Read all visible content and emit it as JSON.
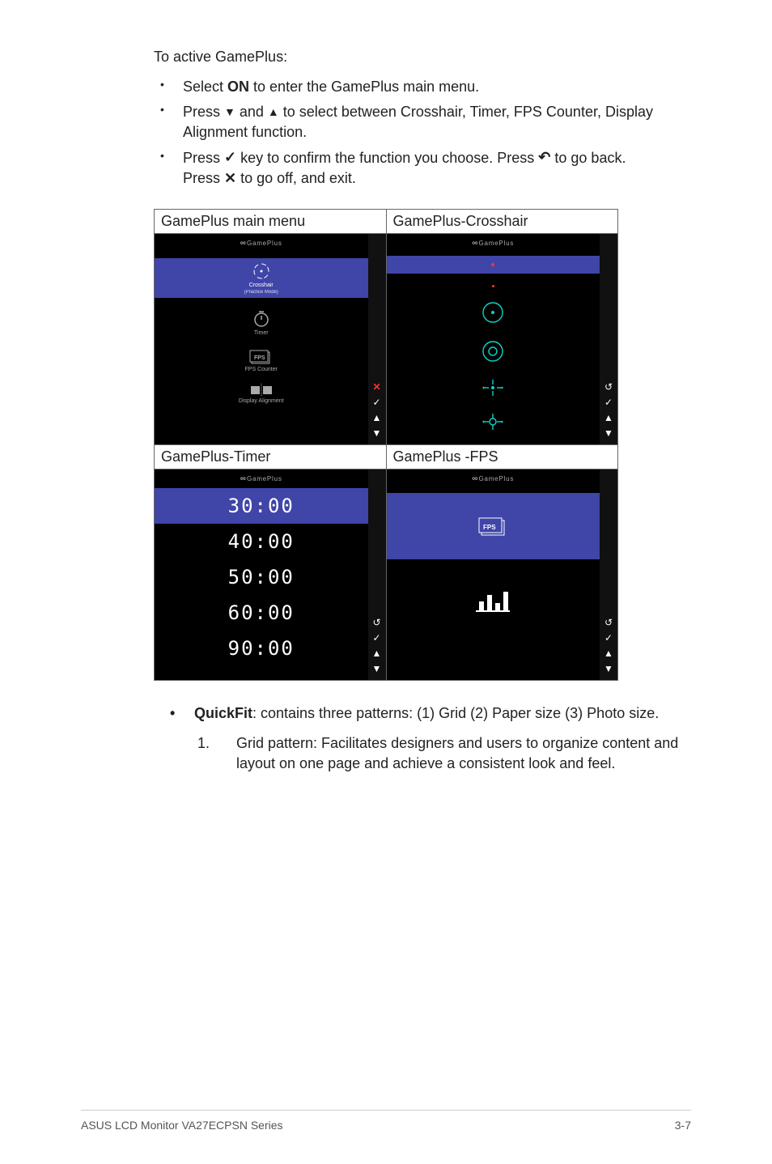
{
  "intro": "To active GamePlus:",
  "bullet1_pre": "Select ",
  "bullet1_bold": "ON",
  "bullet1_post": " to enter the GamePlus main menu.",
  "bullet2_pre": "Press ",
  "bullet2_mid": " and ",
  "bullet2_post": " to select between Crosshair, Timer, FPS Counter, Display Alignment function.",
  "bullet3a_pre": "Press ",
  "bullet3a_mid": " key to confirm the function you choose. Press ",
  "bullet3a_post": " to go back.",
  "bullet3b_pre": "Press ",
  "bullet3b_post": " to go off, and exit.",
  "qf_pre": "QuickFit",
  "qf_post": ": contains three patterns: (1) Grid (2) Paper size (3) Photo size.",
  "qf_item1": "Grid pattern: Facilitates designers and users to organize content and layout on one page and achieve a consistent look and feel.",
  "grid": {
    "mainmenu": {
      "title": "GamePlus main menu",
      "header": "GamePlus",
      "item1a": "Crosshair",
      "item1b": "(Practice Mode)",
      "item2": "Timer",
      "item3": "FPS Counter",
      "item4": "Display Alignment"
    },
    "crosshair": {
      "title": "GamePlus-Crosshair",
      "header": "GamePlus"
    },
    "timer": {
      "title": "GamePlus-Timer",
      "header": "GamePlus",
      "values": [
        "30:00",
        "40:00",
        "50:00",
        "60:00",
        "90:00"
      ]
    },
    "fps": {
      "title": "GamePlus -FPS",
      "header": "GamePlus",
      "fps_label": "FPS"
    }
  },
  "side": {
    "x": "✕",
    "check": "✓",
    "up": "▲",
    "down": "▼",
    "back": "↺"
  },
  "footer_left": "ASUS LCD Monitor VA27ECPSN Series",
  "footer_right": "3-7"
}
